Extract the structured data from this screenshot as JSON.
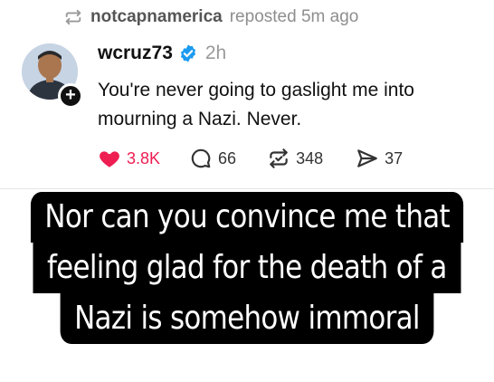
{
  "repost": {
    "user": "notcapnamerica",
    "text": "reposted 5m ago",
    "icon": "repost-icon"
  },
  "post": {
    "username": "wcruz73",
    "time": "2h",
    "text_line1": "You're never going to gaslight me into",
    "text_line2": "mourning a Nazi. Never.",
    "follow_symbol": "+"
  },
  "actions": {
    "likes": "3.8K",
    "replies": "66",
    "reposts": "348",
    "shares": "37",
    "like_color": "#ee1d52"
  },
  "caption": {
    "line1": "Nor can you convince me that",
    "line2": "feeling glad for the death of a",
    "line3": "Nazi is somehow immoral"
  }
}
